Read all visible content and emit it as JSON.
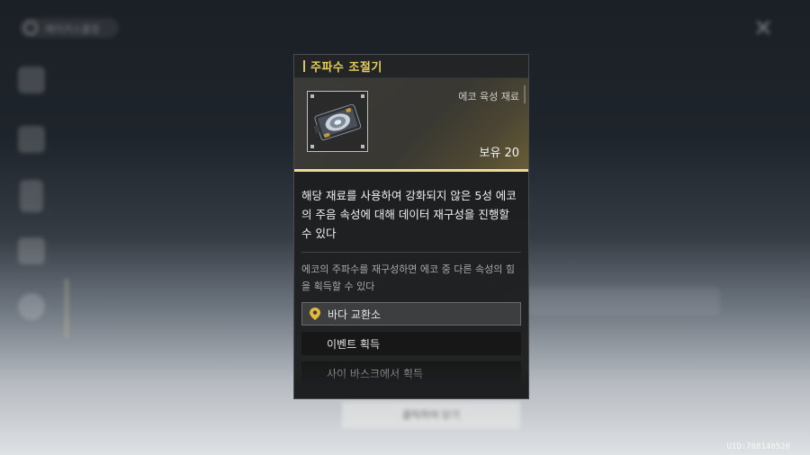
{
  "background": {
    "topbar_label": "에이커스쿨정",
    "close_symbol": "✕",
    "close_label_icon": "close-icon",
    "dismiss_hint": "클릭하여 닫기",
    "uid": "UID:708140520"
  },
  "tooltip": {
    "title": "주파수 조절기",
    "category": "에코 육성 재료",
    "owned_label": "보유",
    "owned_count": "20",
    "description": "해당 재료를 사용하여 강화되지 않은 5성 에코의 주음 속성에 대해 데이터 재구성을 진행할 수 있다",
    "flavor": "에코의 주파수를 재구성하면 에코 중 다른 속성의 힘을 획득할 수 있다",
    "sources": [
      {
        "label": "바다 교환소",
        "icon": "location-pin-icon"
      },
      {
        "label": "이벤트 획득"
      },
      {
        "label": "사이 바스크에서 획득"
      }
    ]
  },
  "colors": {
    "accent_gold": "#e7cf5a",
    "panel_bg": "#1e1f20"
  }
}
